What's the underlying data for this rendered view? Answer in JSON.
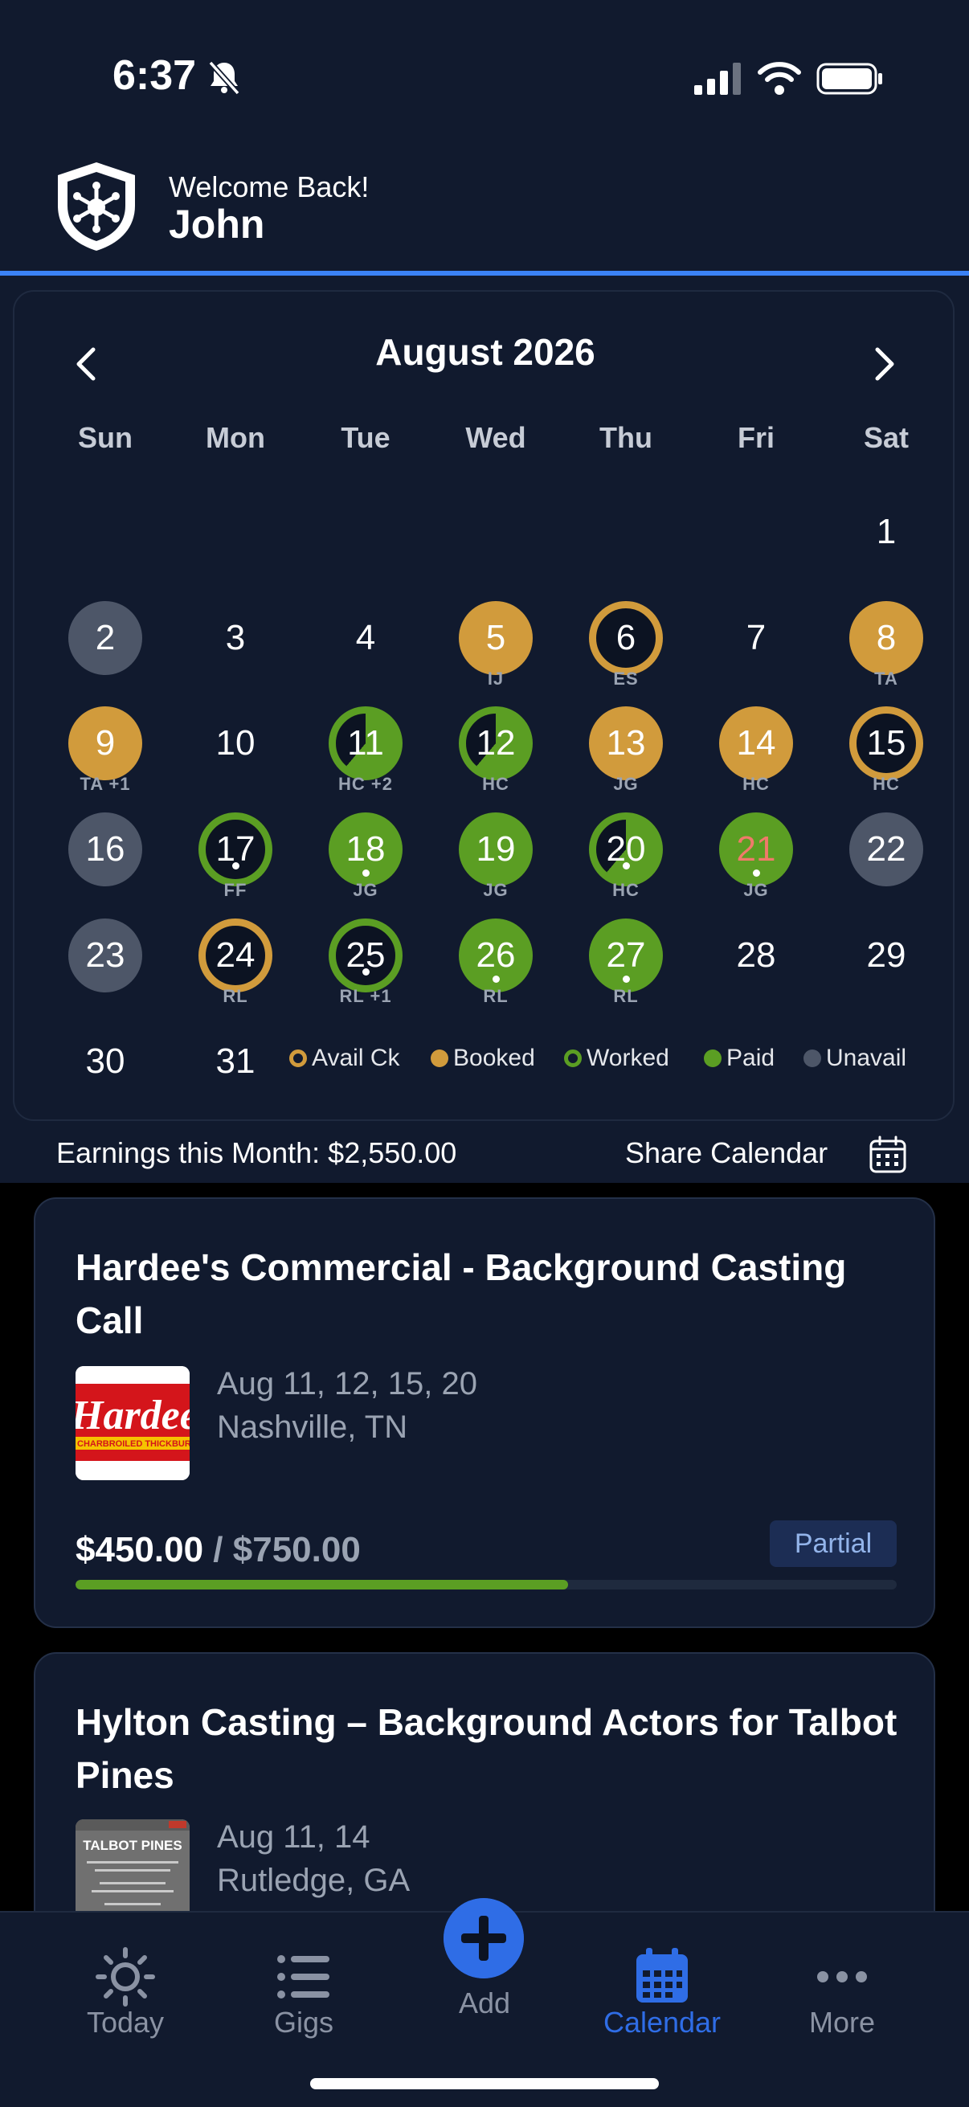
{
  "status_bar": {
    "time": "6:37"
  },
  "header": {
    "welcome": "Welcome Back!",
    "user_name": "John"
  },
  "calendar": {
    "month_label": "August 2026",
    "weekdays": [
      "Sun",
      "Mon",
      "Tue",
      "Wed",
      "Thu",
      "Fri",
      "Sat"
    ],
    "days": [
      {
        "n": "1",
        "status": "none",
        "tag": ""
      },
      {
        "n": "2",
        "status": "unavail",
        "tag": ""
      },
      {
        "n": "3",
        "status": "none",
        "tag": ""
      },
      {
        "n": "4",
        "status": "none",
        "tag": ""
      },
      {
        "n": "5",
        "status": "booked",
        "tag": "IJ"
      },
      {
        "n": "6",
        "status": "avail-ck",
        "tag": "ES"
      },
      {
        "n": "7",
        "status": "none",
        "tag": ""
      },
      {
        "n": "8",
        "status": "booked",
        "tag": "TA"
      },
      {
        "n": "9",
        "status": "booked",
        "tag": "TA +1"
      },
      {
        "n": "10",
        "status": "none",
        "tag": ""
      },
      {
        "n": "11",
        "status": "mixed-green",
        "tag": "HC +2"
      },
      {
        "n": "12",
        "status": "mixed-green",
        "tag": "HC"
      },
      {
        "n": "13",
        "status": "booked",
        "tag": "JG"
      },
      {
        "n": "14",
        "status": "booked",
        "tag": "HC"
      },
      {
        "n": "15",
        "status": "avail-ck",
        "tag": "HC"
      },
      {
        "n": "16",
        "status": "unavail",
        "tag": ""
      },
      {
        "n": "17",
        "status": "worked",
        "tag": "FF",
        "dot": true
      },
      {
        "n": "18",
        "status": "paid",
        "tag": "JG",
        "dot": true
      },
      {
        "n": "19",
        "status": "paid",
        "tag": "JG"
      },
      {
        "n": "20",
        "status": "mixed-green",
        "tag": "HC",
        "dot": true
      },
      {
        "n": "21",
        "status": "paid",
        "tag": "JG",
        "dot": true,
        "text_color": "#f07a6a"
      },
      {
        "n": "22",
        "status": "unavail",
        "tag": ""
      },
      {
        "n": "23",
        "status": "unavail",
        "tag": ""
      },
      {
        "n": "24",
        "status": "avail-ck",
        "tag": "RL"
      },
      {
        "n": "25",
        "status": "worked",
        "tag": "RL +1",
        "dot": true
      },
      {
        "n": "26",
        "status": "paid",
        "tag": "RL",
        "dot": true
      },
      {
        "n": "27",
        "status": "paid",
        "tag": "RL",
        "dot": true
      },
      {
        "n": "28",
        "status": "none",
        "tag": ""
      },
      {
        "n": "29",
        "status": "none",
        "tag": ""
      },
      {
        "n": "30",
        "status": "none",
        "tag": ""
      },
      {
        "n": "31",
        "status": "none",
        "tag": ""
      }
    ],
    "legend": [
      {
        "label": "Avail Ck",
        "kind": "ring",
        "color": "#d19b3c"
      },
      {
        "label": "Booked",
        "kind": "fill",
        "color": "#d19b3c"
      },
      {
        "label": "Worked",
        "kind": "ring",
        "color": "#5b9e23"
      },
      {
        "label": "Paid",
        "kind": "fill",
        "color": "#5b9e23"
      },
      {
        "label": "Unavail",
        "kind": "fill",
        "color": "#4d5668"
      }
    ]
  },
  "summary": {
    "earnings": "Earnings this Month: $2,550.00",
    "share_label": "Share Calendar"
  },
  "gigs": [
    {
      "title": "Hardee's Commercial - Background Casting Call",
      "dates": "Aug 11, 12, 15, 20",
      "location": "Nashville, TN",
      "paid": "$450.00",
      "separator": " / ",
      "total": "$750.00",
      "status": "Partial",
      "progress": 0.6,
      "thumb_text": "Hardee's",
      "thumb_sub": "CHARBROILED THICKBURGERS"
    },
    {
      "title": "Hylton Casting – Background Actors for Talbot Pines",
      "dates": "Aug 11, 14",
      "location": "Rutledge, GA",
      "thumb_text": "TALBOT PINES"
    }
  ],
  "tabbar": {
    "today": "Today",
    "gigs": "Gigs",
    "add": "Add",
    "calendar": "Calendar",
    "more": "More"
  },
  "colors": {
    "accent": "#3b82f6",
    "booked": "#d19b3c",
    "paid": "#5b9e23",
    "unavail": "#4d5668",
    "active_tab": "#2f6de6"
  }
}
